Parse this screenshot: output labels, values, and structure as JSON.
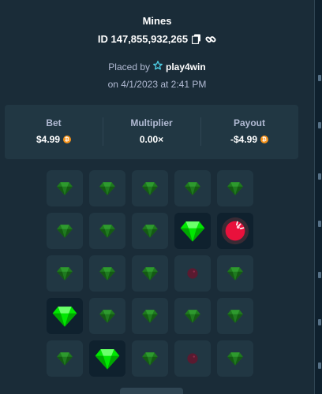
{
  "game": {
    "title": "Mines",
    "id_text": "ID 147,855,932,265"
  },
  "icons": {
    "copy": "copy-icon",
    "link": "link-icon",
    "vip": "star-icon",
    "coin": "bitcoin-coin-icon",
    "gem": "gem-icon",
    "mine": "mine-icon"
  },
  "placed": {
    "prefix": "Placed by",
    "username": "play4win",
    "date_text": "on 4/1/2023 at 2:41 PM"
  },
  "stats": {
    "bet_label": "Bet",
    "bet_value": "$4.99",
    "multiplier_label": "Multiplier",
    "multiplier_value": "0.00×",
    "payout_label": "Payout",
    "payout_value": "-$4.99"
  },
  "board": {
    "rows": [
      [
        "gem",
        "gem",
        "gem",
        "gem",
        "gem"
      ],
      [
        "gem",
        "gem",
        "gem",
        "gem-revealed",
        "mine-hit"
      ],
      [
        "gem",
        "gem",
        "gem",
        "mine",
        "gem"
      ],
      [
        "gem-revealed",
        "gem",
        "gem",
        "gem",
        "gem"
      ],
      [
        "gem",
        "gem-revealed",
        "gem",
        "mine",
        "gem"
      ]
    ]
  },
  "colors": {
    "background": "#1a2c38",
    "panel": "#213743",
    "gem_dim": "#1f7a1f",
    "gem_bright": "#00e701",
    "mine": "#e9113c",
    "coin": "#f7931a"
  }
}
